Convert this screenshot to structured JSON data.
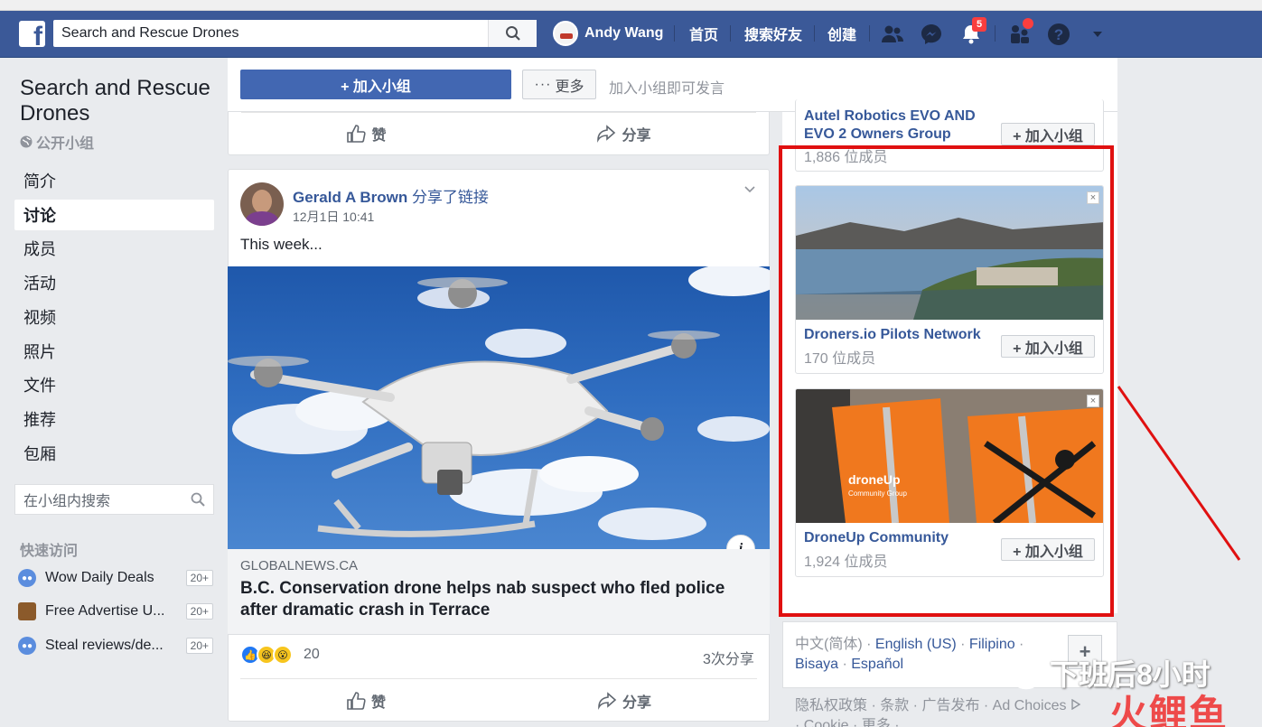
{
  "topbar": {
    "search_value": "Search and Rescue Drones",
    "user_name": "Andy Wang",
    "nav": [
      "首页",
      "搜索好友",
      "创建"
    ],
    "notification_count": "5",
    "brand_color": "#3b5998"
  },
  "left": {
    "group_name": "Search and Rescue Drones",
    "privacy": "公开小组",
    "nav": [
      "简介",
      "讨论",
      "成员",
      "活动",
      "视频",
      "照片",
      "文件",
      "推荐",
      "包厢"
    ],
    "active_nav": "讨论",
    "group_search_placeholder": "在小组内搜索",
    "quick_title": "快速访问",
    "quick_items": [
      {
        "name": "Wow Daily Deals",
        "count": "20+"
      },
      {
        "name": "Free Advertise U...",
        "count": "20+"
      },
      {
        "name": "Steal reviews/de...",
        "count": "20+"
      }
    ]
  },
  "join": {
    "join_label": "+ 加入小组",
    "more_label": "更多",
    "hint": "加入小组即可发言"
  },
  "actions": {
    "like": "赞",
    "share": "分享"
  },
  "post": {
    "author": "Gerald A Brown",
    "verb": "分享了链接",
    "time": "12月1日 10:41",
    "text": "This week...",
    "link_domain": "GLOBALNEWS.CA",
    "link_title": "B.C. Conservation drone helps nab suspect who fled police after dramatic crash in Terrace",
    "reaction_count": "20",
    "share_count": "3次分享"
  },
  "suggested": [
    {
      "name": "Autel Robotics EVO AND EVO 2 Owners Group",
      "members": "1,886 位成员",
      "join": "+ 加入小组"
    },
    {
      "name": "Droners.io Pilots Network",
      "members": "170 位成员",
      "join": "+ 加入小组"
    },
    {
      "name": "DroneUp Community",
      "members": "1,924 位成员",
      "join": "+ 加入小组",
      "ad_overlay": "droneUp",
      "ad_overlay_sub": "Community Group"
    }
  ],
  "footer": {
    "langs": [
      "中文(简体)",
      "English (US)",
      "Filipino",
      "Bisaya",
      "Español"
    ],
    "links": "隐私权政策 · 条款 · 广告发布 · Ad Choices",
    "links2": "· Cookie · 更多 ·"
  },
  "watermark": {
    "line1": "下班后8小时",
    "line2": "火鲤鱼"
  }
}
